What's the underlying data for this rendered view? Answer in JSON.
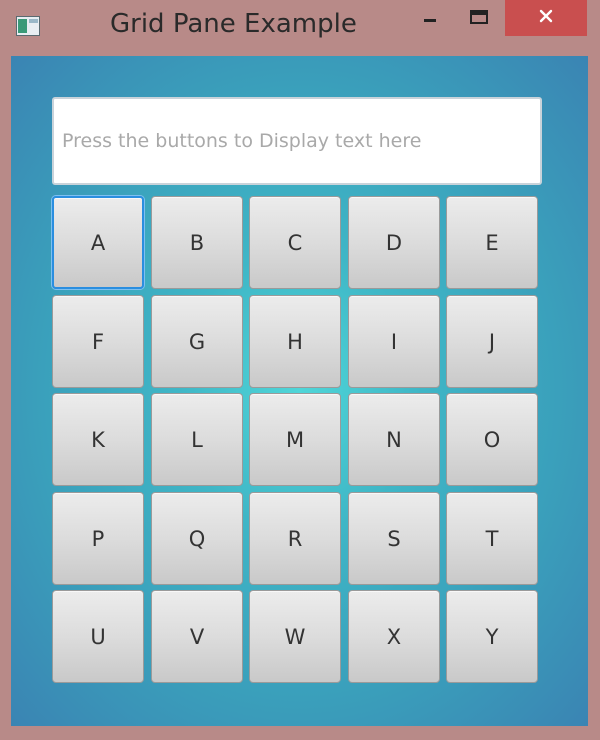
{
  "window": {
    "title": "Grid Pane Example",
    "controls": {
      "minimize": "minimize-icon",
      "maximize": "maximize-icon",
      "close": "close-icon"
    }
  },
  "display": {
    "placeholder": "Press the buttons to Display text here",
    "value": ""
  },
  "keypad": {
    "focused_key": "A",
    "rows": [
      [
        "A",
        "B",
        "C",
        "D",
        "E"
      ],
      [
        "F",
        "G",
        "H",
        "I",
        "J"
      ],
      [
        "K",
        "L",
        "M",
        "N",
        "O"
      ],
      [
        "P",
        "Q",
        "R",
        "S",
        "T"
      ],
      [
        "U",
        "V",
        "W",
        "X",
        "Y"
      ]
    ]
  },
  "colors": {
    "titlebar": "#b88a88",
    "close_button": "#c94f4f",
    "focus_ring": "#2a8ee0"
  }
}
